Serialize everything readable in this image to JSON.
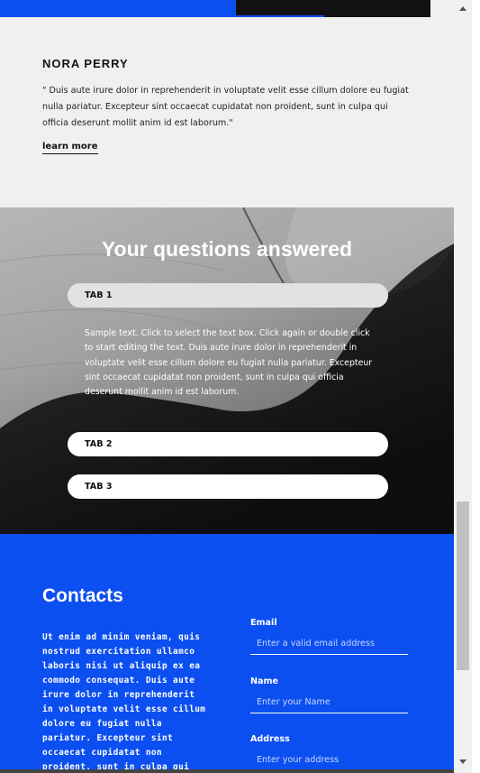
{
  "testimonial": {
    "name": "NORA PERRY",
    "quote": "\" Duis aute irure dolor in reprehenderit in voluptate velit esse cillum dolore eu fugiat nulla pariatur. Excepteur sint occaecat cupidatat non proident, sunt in culpa qui officia deserunt mollit anim id est laborum.\"",
    "link": "learn more"
  },
  "faq": {
    "title": "Your questions answered",
    "tabs": [
      {
        "label": "TAB 1",
        "active": true,
        "content": "Sample text. Click to select the text box. Click again or double click to start editing the text. Duis aute irure dolor in reprehenderit in voluptate velit esse cillum dolore eu fugiat nulla pariatur. Excepteur sint occaecat cupidatat non proident, sunt in culpa qui officia deserunt mollit anim id est laborum."
      },
      {
        "label": "TAB 2",
        "active": false
      },
      {
        "label": "TAB 3",
        "active": false
      }
    ]
  },
  "contacts": {
    "title": "Contacts",
    "text": "Ut enim ad minim veniam, quis nostrud exercitation ullamco laboris nisi ut aliquip ex ea commodo consequat. Duis aute irure dolor in reprehenderit in voluptate velit esse cillum dolore eu fugiat nulla pariatur. Excepteur sint occaecat cupidatat non proident, sunt in culpa qui officia deserunt mollit",
    "fields": [
      {
        "label": "Email",
        "placeholder": "Enter a valid email address"
      },
      {
        "label": "Name",
        "placeholder": "Enter your Name"
      },
      {
        "label": "Address",
        "placeholder": "Enter your address"
      }
    ]
  },
  "colors": {
    "accent": "#0c4ff0",
    "section_bg": "#f0f0f0"
  }
}
